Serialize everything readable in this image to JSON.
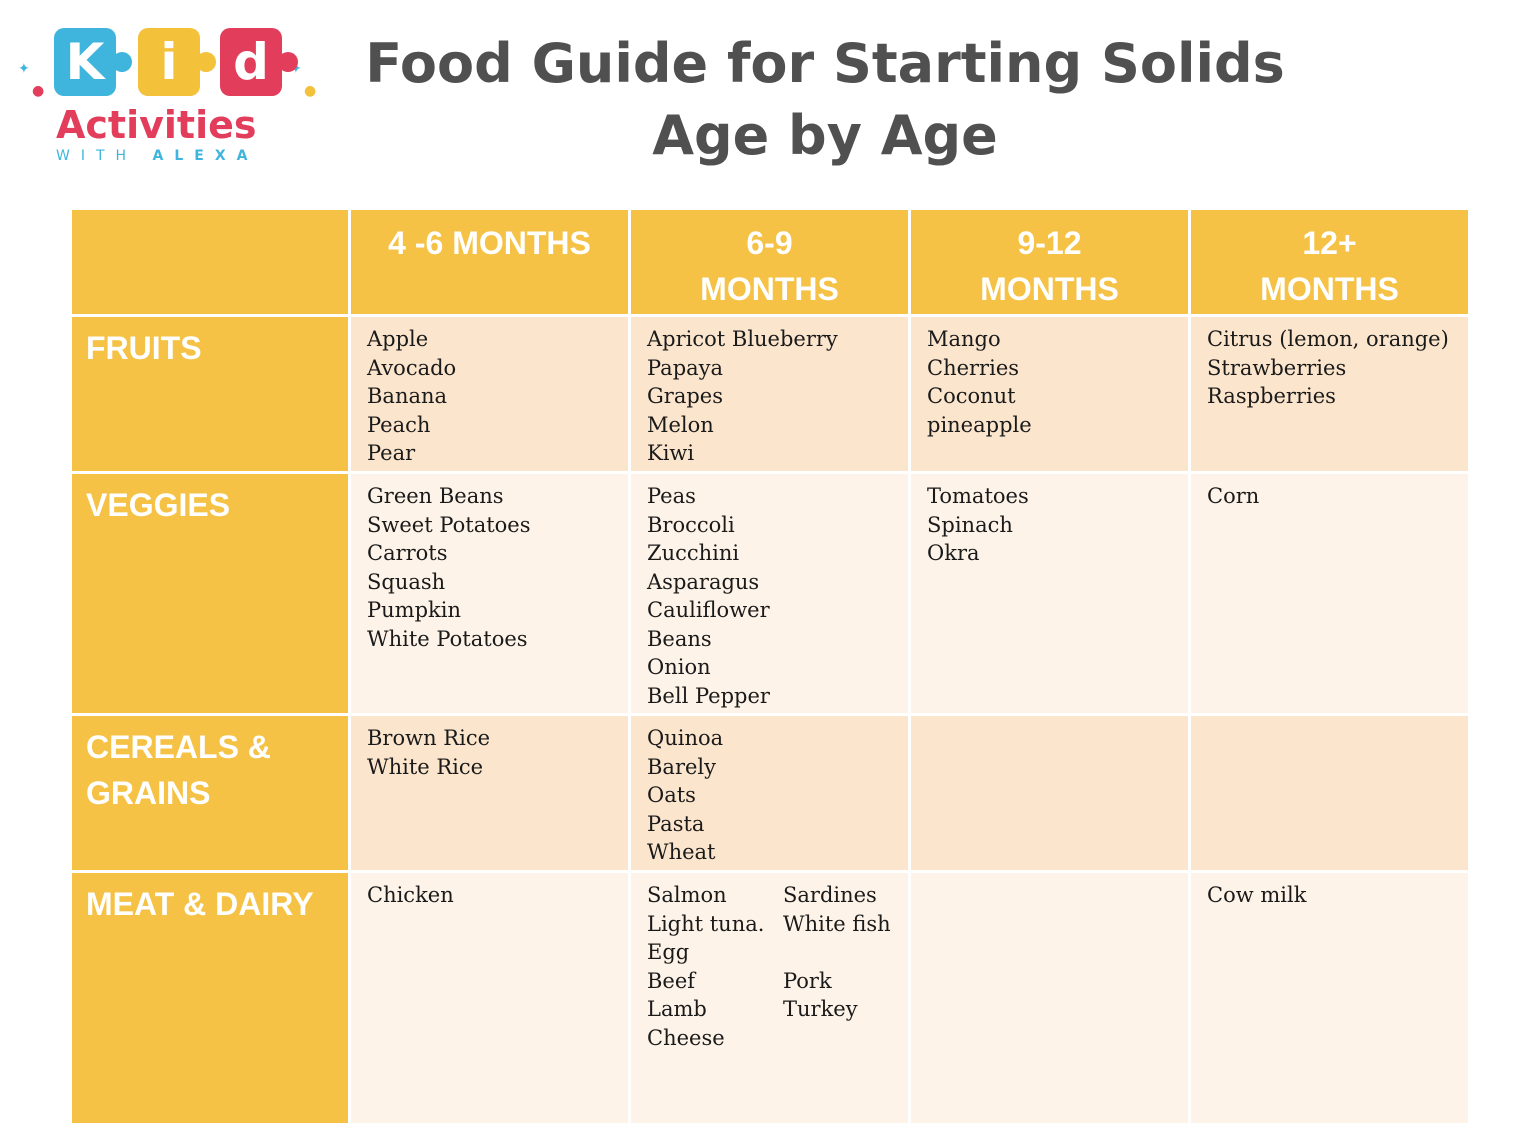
{
  "logo": {
    "letters": [
      "K",
      "i",
      "d"
    ],
    "activities": "Activities",
    "with": "WITH",
    "alexa": "ALEXA",
    "colors": {
      "blue": "#3fb5de",
      "yellow": "#f3c13a",
      "red": "#e23e5c"
    }
  },
  "title": {
    "line1": "Food Guide for Starting Solids",
    "line2": "Age by Age"
  },
  "table": {
    "colors": {
      "header": "#f5c245",
      "row_light": "#fdf3e8",
      "row_dark": "#fbe5cd"
    },
    "columns": [
      {
        "lines": [
          "4 -6 MONTHS"
        ]
      },
      {
        "lines": [
          "6-9",
          "MONTHS"
        ]
      },
      {
        "lines": [
          "9-12",
          "MONTHS"
        ]
      },
      {
        "lines": [
          "12+",
          "MONTHS"
        ]
      }
    ],
    "rows": [
      {
        "label_lines": [
          "FRUITS"
        ],
        "cells": [
          [
            "Apple",
            "Avocado",
            "Banana",
            "Peach",
            "Pear"
          ],
          [
            "Apricot Blueberry",
            "Papaya",
            "Grapes",
            "Melon",
            "Kiwi"
          ],
          [
            "Mango",
            "Cherries",
            "Coconut",
            "pineapple"
          ],
          [
            "Citrus (lemon, orange)",
            "Strawberries",
            "Raspberries"
          ]
        ]
      },
      {
        "label_lines": [
          "VEGGIES"
        ],
        "cells": [
          [
            "Green Beans",
            "Sweet Potatoes",
            "Carrots",
            "Squash",
            "Pumpkin",
            "White Potatoes"
          ],
          [
            "Peas",
            "Broccoli",
            "Zucchini",
            "Asparagus",
            "Cauliflower",
            "Beans",
            "Onion",
            "Bell Pepper"
          ],
          [
            "Tomatoes",
            "Spinach",
            "Okra"
          ],
          [
            "Corn"
          ]
        ]
      },
      {
        "label_lines": [
          "CEREALS &",
          "GRAINS"
        ],
        "cells": [
          [
            "Brown Rice",
            "White Rice"
          ],
          [
            "Quinoa",
            "Barely",
            "Oats",
            "Pasta",
            "Wheat"
          ],
          [],
          []
        ]
      },
      {
        "label_lines": [
          "MEAT & DAIRY"
        ],
        "cells": [
          [
            "Chicken"
          ],
          {
            "col_a": [
              "Salmon",
              "Light tuna.",
              "Egg",
              "Beef",
              "Lamb",
              "Cheese"
            ],
            "col_b": [
              "Sardines",
              "White fish",
              "",
              "Pork",
              "Turkey"
            ]
          },
          [],
          [
            "Cow milk"
          ]
        ]
      }
    ]
  }
}
